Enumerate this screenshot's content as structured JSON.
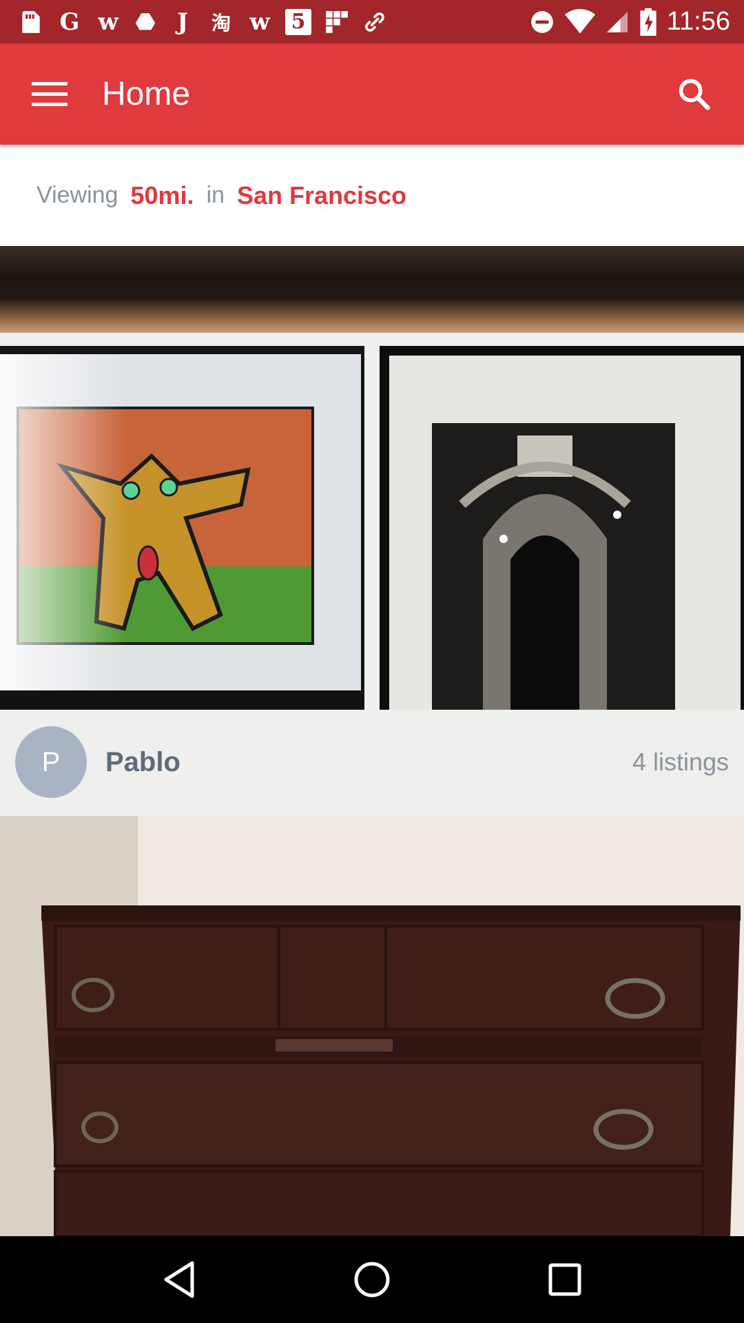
{
  "status_bar": {
    "notification_icons": [
      "G",
      "w",
      "J",
      "淘",
      "w",
      "5"
    ],
    "time": "11:56"
  },
  "app_bar": {
    "title": "Home"
  },
  "location": {
    "prefix": "Viewing",
    "radius": "50mi.",
    "connector": "in",
    "city": "San Francisco"
  },
  "seller": {
    "avatar_initial": "P",
    "name": "Pablo",
    "listings": "4 listings"
  },
  "colors": {
    "brand": "#e0393e",
    "status_bar": "#a2262a",
    "avatar": "#a8b4c4"
  }
}
